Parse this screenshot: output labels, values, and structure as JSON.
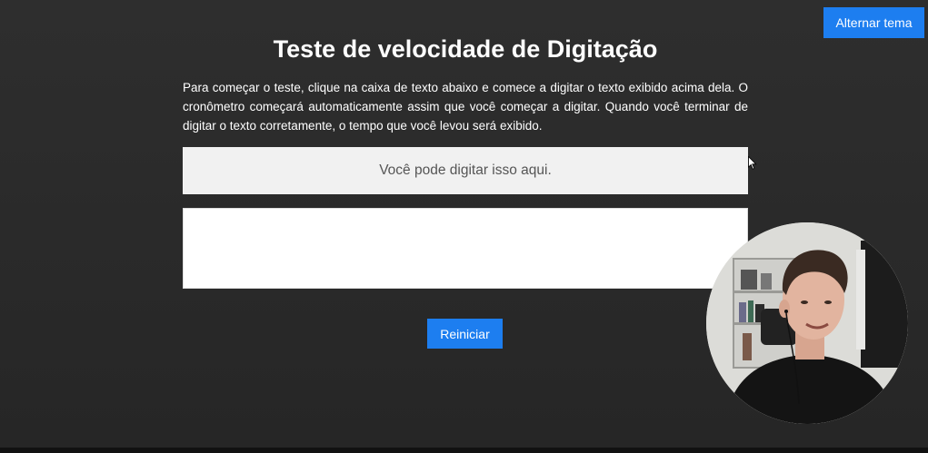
{
  "header": {
    "theme_toggle_label": "Alternar tema"
  },
  "main": {
    "title": "Teste de velocidade de Digitação",
    "instructions": "Para começar o teste, clique na caixa de texto abaixo e comece a digitar o texto exibido acima dela. O cronômetro começará automaticamente assim que você começar a digitar. Quando você terminar de digitar o texto corretamente, o tempo que você levou será exibido.",
    "prompt_text": "Você pode digitar isso aqui.",
    "input_value": "",
    "restart_label": "Reiniciar"
  },
  "colors": {
    "background": "#2b2b2b",
    "accent": "#1d7ef0",
    "prompt_bg": "#f1f1f1",
    "text": "#ffffff"
  },
  "icons": {
    "pointer": "mouse-pointer-icon"
  }
}
